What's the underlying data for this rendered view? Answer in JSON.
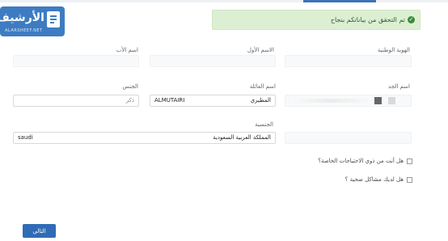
{
  "brand": {
    "name": "الأرشيف",
    "subtitle": "ALARSHEEF.NET"
  },
  "alert": {
    "text": "تم التحقق من بياناتكم بنجاح",
    "color": "#dcefd2"
  },
  "form": {
    "national_id": {
      "label": "الهوية الوطنية",
      "value": ""
    },
    "first_name": {
      "label": "الاسم الأول",
      "value": ""
    },
    "father_name": {
      "label": "اسم الأب",
      "value": ""
    },
    "grandfather_name": {
      "label": "اسم الجد",
      "value": ""
    },
    "family_name": {
      "label": "اسم العائلة",
      "value_ar": "المطيري",
      "value_en": "ALMUTAIRI"
    },
    "gender": {
      "label": "الجنس",
      "value": "ذكر"
    },
    "nationality": {
      "label": "الجنسية",
      "value_ar": "المملكة العربية السعودية",
      "value_en": "saudi"
    }
  },
  "questions": {
    "special_needs": "هل أنت من ذوي الاحتياجات الخاصة؟",
    "health_issues": "هل لديك مشاكل صحية ؟"
  },
  "actions": {
    "next": "التالي"
  },
  "colors": {
    "primary": "#2f6cb5",
    "success_bg": "#dcefd2",
    "success_text": "#2f5e2f"
  }
}
